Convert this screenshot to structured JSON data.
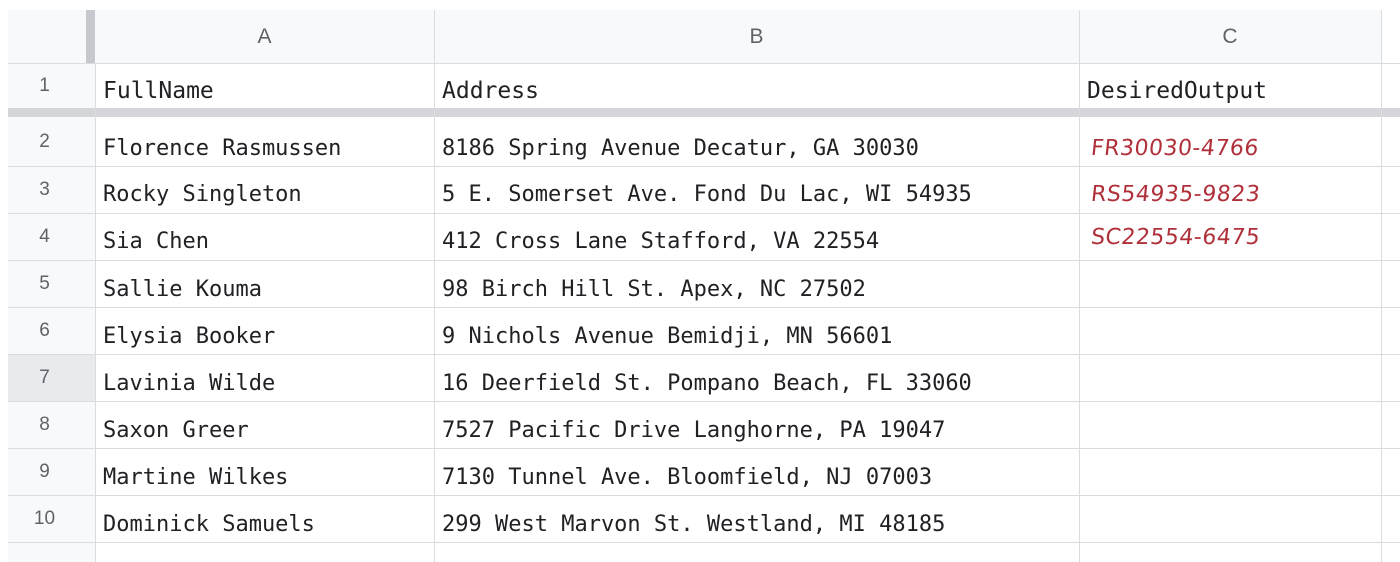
{
  "columns": [
    "A",
    "B",
    "C"
  ],
  "row_numbers": [
    "1",
    "2",
    "3",
    "4",
    "5",
    "6",
    "7",
    "8",
    "9",
    "10"
  ],
  "header_row": {
    "A": "FullName",
    "B": "Address",
    "C": "DesiredOutput"
  },
  "rows": [
    {
      "name": "Florence Rasmussen",
      "address": "8186 Spring Avenue Decatur, GA 30030",
      "output": "FR30030-4766"
    },
    {
      "name": "Rocky Singleton",
      "address": "5 E. Somerset Ave. Fond Du Lac, WI 54935",
      "output": "RS54935-9823"
    },
    {
      "name": "Sia Chen",
      "address": "412 Cross Lane Stafford, VA 22554",
      "output": "SC22554-6475"
    },
    {
      "name": "Sallie Kouma",
      "address": "98 Birch Hill St. Apex, NC 27502",
      "output": ""
    },
    {
      "name": "Elysia Booker",
      "address": "9 Nichols Avenue Bemidji, MN 56601",
      "output": ""
    },
    {
      "name": "Lavinia Wilde",
      "address": "16 Deerfield St. Pompano Beach, FL 33060",
      "output": ""
    },
    {
      "name": "Saxon Greer",
      "address": "7527 Pacific Drive Langhorne, PA 19047",
      "output": ""
    },
    {
      "name": "Martine Wilkes",
      "address": "7130 Tunnel Ave. Bloomfield, NJ 07003",
      "output": ""
    },
    {
      "name": "Dominick Samuels",
      "address": "299 West Marvon St. Westland, MI 48185",
      "output": ""
    }
  ],
  "selected_row": "7",
  "colors": {
    "header_bg": "#f8f9fa",
    "gridline": "#dadce0",
    "freeze_bar": "#d4d6d9",
    "handwriting": "#b0303a",
    "text": "#202124"
  }
}
